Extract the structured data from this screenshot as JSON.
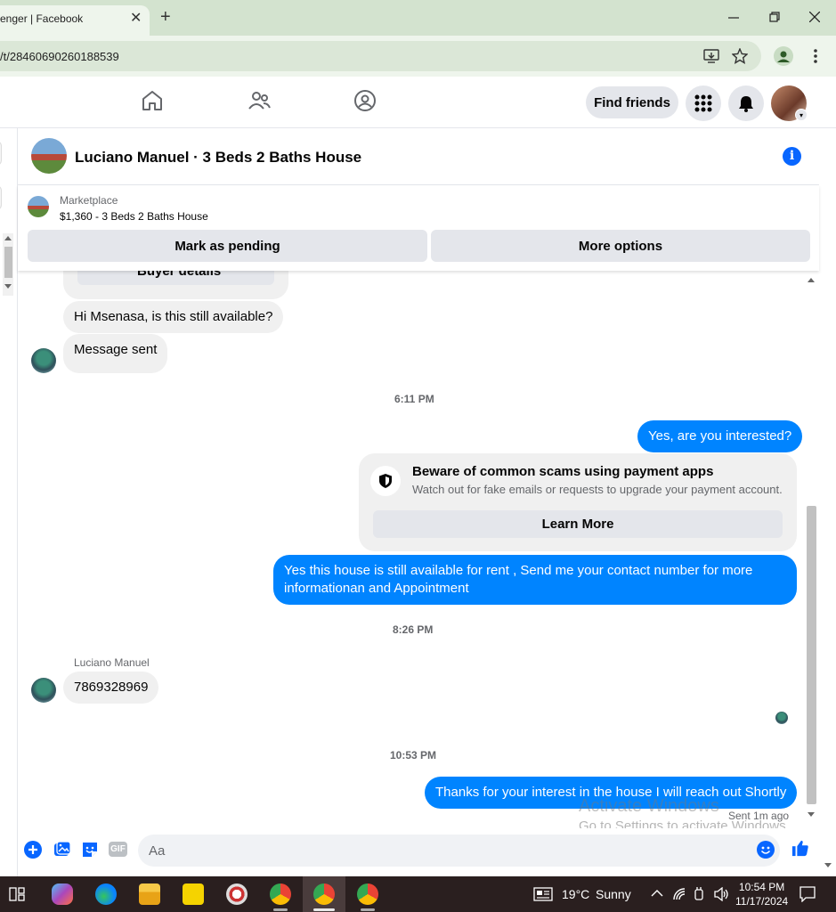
{
  "browser": {
    "tab_title": "enger | Facebook",
    "url": "/t/28460690260188539",
    "new_tab": "+",
    "close_tab": "✕"
  },
  "header": {
    "find_friends": "Find friends"
  },
  "conversation": {
    "title": "Luciano Manuel · 3 Beds 2 Baths House",
    "marketplace_label": "Marketplace",
    "listing": "$1,360 - 3 Beds 2 Baths House",
    "mark_pending": "Mark as pending",
    "more_options": "More options"
  },
  "messages": {
    "partial_card_text": "Buyer details",
    "msg1": "Hi Msenasa, is this still available?",
    "msg2": "Message sent",
    "ts1": "6:11 PM",
    "msg3": "Yes, are you interested?",
    "scam_title": "Beware of common scams using payment apps",
    "scam_sub": "Watch out for fake emails or requests to upgrade your payment account.",
    "learn_more": "Learn More",
    "msg4": "Yes this house is still available for rent , Send me your contact number for more informationan and Appointment",
    "ts2": "8:26 PM",
    "sender_name": "Luciano Manuel",
    "msg5": "7869328969",
    "ts3": "10:53 PM",
    "msg6": "Thanks for your interest in the house I will reach out Shortly",
    "sent_status": "Sent 1m ago"
  },
  "composer": {
    "placeholder": "Aa",
    "gif_label": "GIF"
  },
  "watermark": {
    "line1": "Activate Windows",
    "line2": "Go to Settings to activate Windows."
  },
  "taskbar": {
    "weather_temp": "19°C",
    "weather_desc": "Sunny",
    "time": "10:54 PM",
    "date": "11/17/2024"
  },
  "colors": {
    "accent": "#0084ff",
    "chrome_frame": "#d3e3cf",
    "taskbar": "#2a1f1f"
  }
}
